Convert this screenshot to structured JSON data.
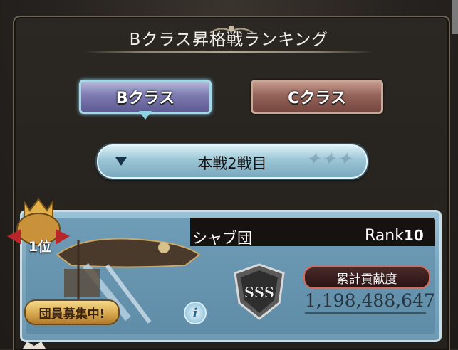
{
  "header": {
    "title": "Bクラス昇格戦ランキング"
  },
  "class_tabs": [
    {
      "label": "Bクラス",
      "selected": true
    },
    {
      "label": "Cクラス",
      "selected": false
    }
  ],
  "battle_select": {
    "label": "本戦2戦目"
  },
  "ranking_entry": {
    "position_label": "1位",
    "guild_name": "シャブ団",
    "rank_prefix": "Rank",
    "rank_value": "10",
    "recruit_label": "団員募集中!",
    "info_label": "i",
    "grade": "SSS",
    "contribution_label": "累計貢献度",
    "contribution_value": "1,198,488,647"
  },
  "colors": {
    "selected_tab": "#7d7bb0",
    "unselected_tab": "#94645a",
    "card_bg": "#7ca8c0",
    "badge_border": "#d86a5a"
  }
}
